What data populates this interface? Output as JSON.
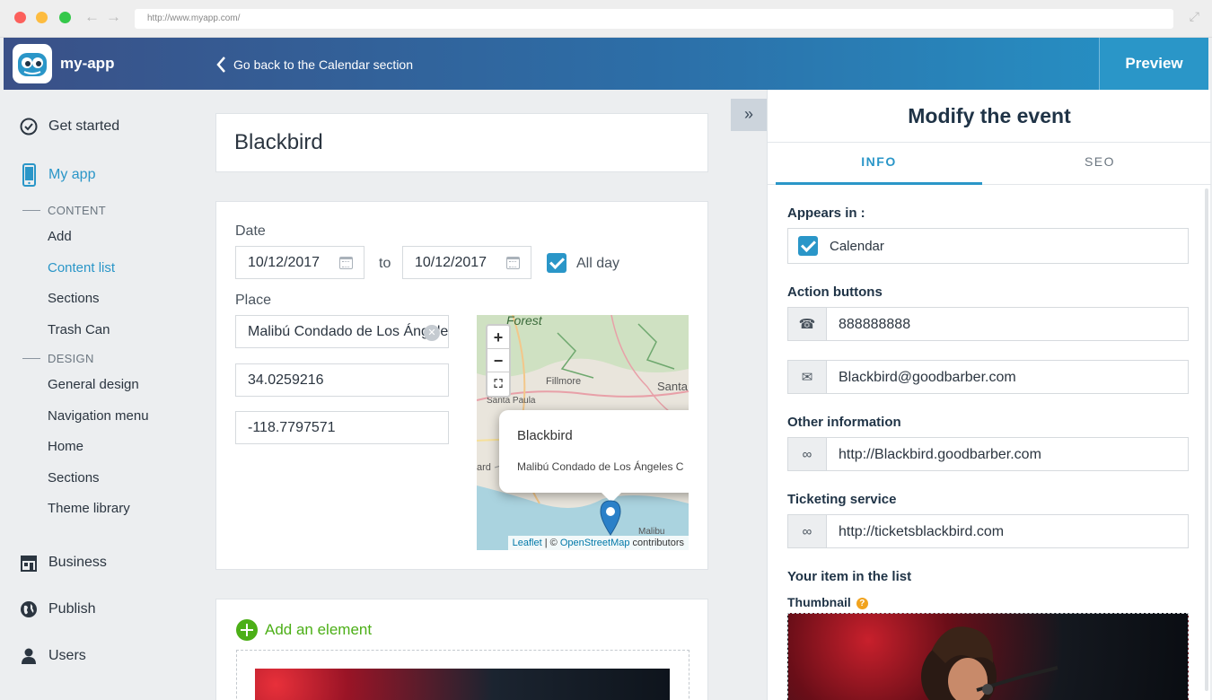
{
  "browser": {
    "url": "http://www.myapp.com/"
  },
  "header": {
    "app_name": "my-app",
    "back_label": "Go back to the Calendar section",
    "preview_label": "Preview"
  },
  "sidebar": {
    "get_started": "Get started",
    "my_app": "My app",
    "content_heading": "CONTENT",
    "content_items": [
      "Add",
      "Content list",
      "Sections",
      "Trash Can"
    ],
    "design_heading": "DESIGN",
    "design_items": [
      "General design",
      "Navigation menu",
      "Home",
      "Sections",
      "Theme library"
    ],
    "business": "Business",
    "publish": "Publish",
    "users": "Users",
    "active_item": "Content list"
  },
  "event": {
    "title": "Blackbird",
    "date_label": "Date",
    "start_date": "10/12/2017",
    "to_label": "to",
    "end_date": "10/12/2017",
    "all_day_label": "All day",
    "all_day_checked": true,
    "place_label": "Place",
    "place_value": "Malibú Condado de Los Ángeles",
    "latitude": "34.0259216",
    "longitude": "-118.7797571"
  },
  "map": {
    "popup_title": "Blackbird",
    "popup_address": "Malibú Condado de Los Ángeles C",
    "attribution_leaflet": "Leaflet",
    "attribution_sep": " | © ",
    "attribution_osm": "OpenStreetMap",
    "attribution_suffix": " contributors",
    "labels": {
      "forest": "Forest",
      "fillmore": "Fillmore",
      "santa": "Santa",
      "santa_paula": "Santa Paula",
      "ard": "ard",
      "malibu": "Malibu"
    },
    "zoom_in": "+",
    "zoom_out": "−"
  },
  "add_element": {
    "label": "Add an element"
  },
  "panel": {
    "title": "Modify the event",
    "tabs": [
      "INFO",
      "SEO"
    ],
    "active_tab": "INFO",
    "appears_in_label": "Appears in :",
    "appears_in_value": "Calendar",
    "action_buttons_label": "Action buttons",
    "phone": "888888888",
    "email": "Blackbird@goodbarber.com",
    "other_info_label": "Other information",
    "other_url": "http://Blackbird.goodbarber.com",
    "ticketing_label": "Ticketing service",
    "ticketing_url": "http://ticketsblackbird.com",
    "list_item_label": "Your item in the list",
    "thumbnail_label": "Thumbnail",
    "help_icon": "?"
  },
  "colors": {
    "accent": "#2a96c8",
    "header_start": "#3a5087",
    "header_end": "#2595c8",
    "add_green": "#4caf17",
    "help_orange": "#f1a31e"
  },
  "icons": [
    "back-chevron-icon",
    "check-circle-icon",
    "phone-device-icon",
    "store-icon",
    "globe-icon",
    "user-icon",
    "calendar-icon",
    "clear-icon",
    "double-chevron-right-icon",
    "phone-icon",
    "envelope-icon",
    "link-icon",
    "help-icon",
    "map-marker-icon",
    "fullscreen-icon"
  ]
}
